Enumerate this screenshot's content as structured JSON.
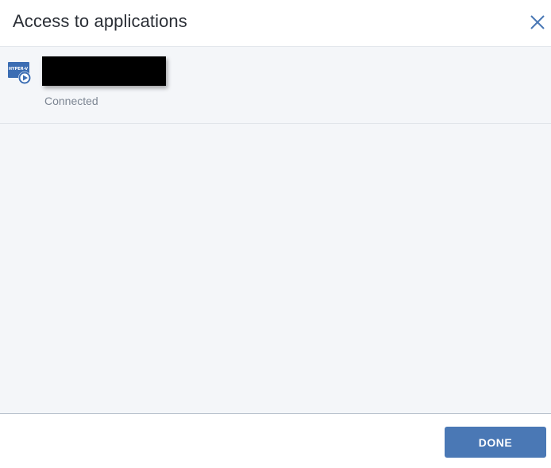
{
  "dialog": {
    "title": "Access to applications",
    "close_icon": "close-icon"
  },
  "machines": [
    {
      "icon": "hyper-v-icon",
      "icon_text": "HYPER-V",
      "name_redacted": true,
      "status": "Connected"
    }
  ],
  "footer": {
    "done_label": "DONE"
  },
  "colors": {
    "accent": "#4a78b5",
    "body_bg": "#f4f6f9",
    "title_text": "#2b2f36",
    "status_text": "#7d8693",
    "close_icon": "#4a78b5"
  }
}
